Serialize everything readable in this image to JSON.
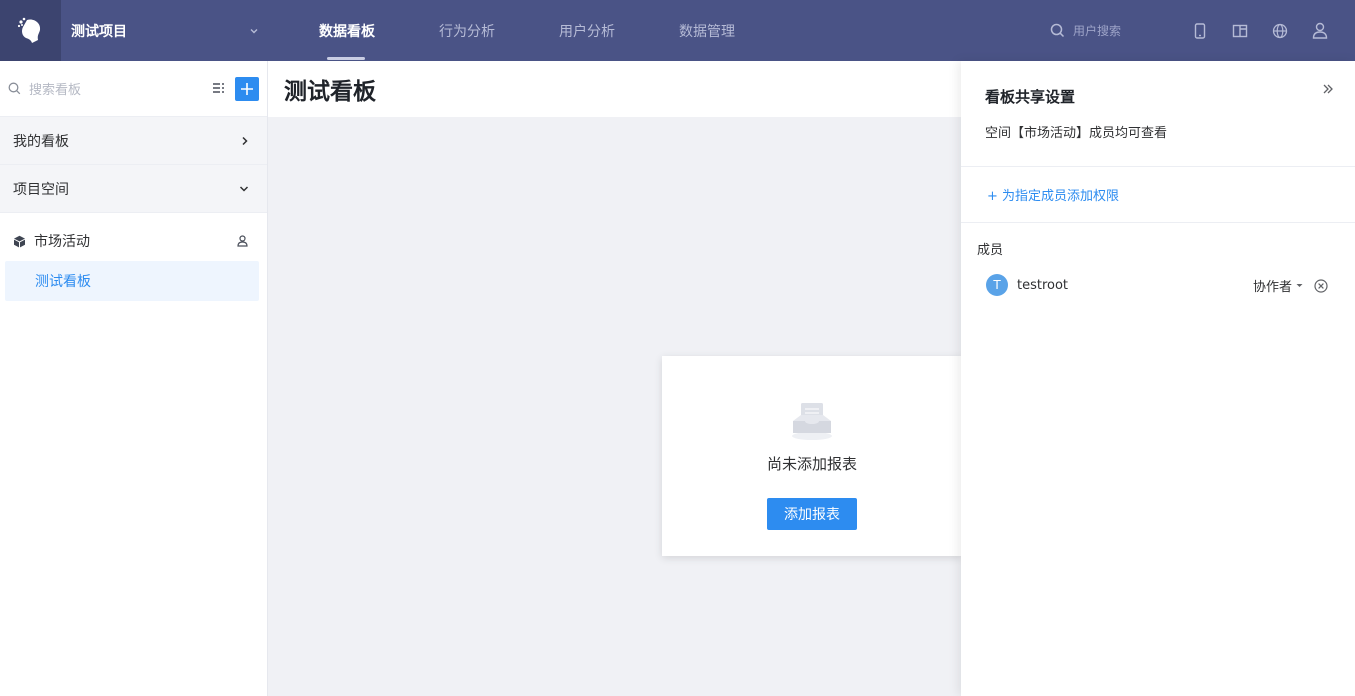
{
  "topbar": {
    "project_name": "测试项目",
    "nav": [
      "数据看板",
      "行为分析",
      "用户分析",
      "数据管理"
    ],
    "search_placeholder": "用户搜索",
    "icons": [
      "logo-icon",
      "chevron-down-icon",
      "search-icon",
      "mobile-icon",
      "layout-icon",
      "globe-icon",
      "user-icon"
    ]
  },
  "sidebar": {
    "search_placeholder": "搜索看板",
    "my_boards": "我的看板",
    "project_space": "项目空间",
    "space_name": "市场活动",
    "board_name": "测试看板"
  },
  "main": {
    "title": "测试看板",
    "empty_text": "尚未添加报表",
    "add_button": "添加报表"
  },
  "panel": {
    "title": "看板共享设置",
    "description": "空间【市场活动】成员均可查看",
    "add_permission": "+ 为指定成员添加权限",
    "members_label": "成员",
    "member": {
      "avatar_letter": "T",
      "name": "testroot",
      "role": "协作者"
    }
  },
  "colors": {
    "topbar": "#4a5386",
    "accent": "#2d8cf0",
    "board_selected_bg": "#eef5fe"
  }
}
